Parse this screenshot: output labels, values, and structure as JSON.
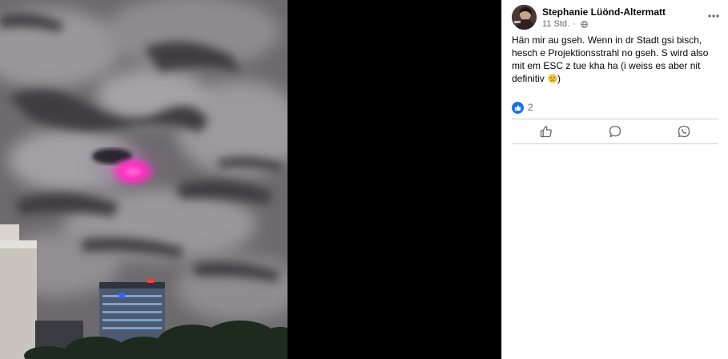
{
  "post": {
    "author": "Stephanie Lüönd-Altermatt",
    "time": "11 Std.",
    "separator": "·",
    "audience_icon": "globe-icon",
    "more_icon": "more-options-icon",
    "text_lines": [
      "Hän mir au gseh. Wenn in dr Stadt gsi bisch,",
      "hesch e Projektionsstrahl no gseh. S wird also",
      "mit em ESC z tue kha ha (i weiss es aber nit",
      "definitiv"
    ],
    "text_end": ")",
    "emoji_icon": "sad-relieved-emoji-icon",
    "reaction_icon": "like-reaction-icon",
    "reaction_count": "2"
  },
  "actions": [
    {
      "icon": "like-icon"
    },
    {
      "icon": "comment-icon"
    },
    {
      "icon": "whatsapp-icon"
    }
  ],
  "colors": {
    "accent": "#1b74e4",
    "text": "#050505",
    "secondary_text": "#65676b",
    "divider": "#ced0d4",
    "media_background": "#000000",
    "sky_glow": "#ff4fc9"
  }
}
